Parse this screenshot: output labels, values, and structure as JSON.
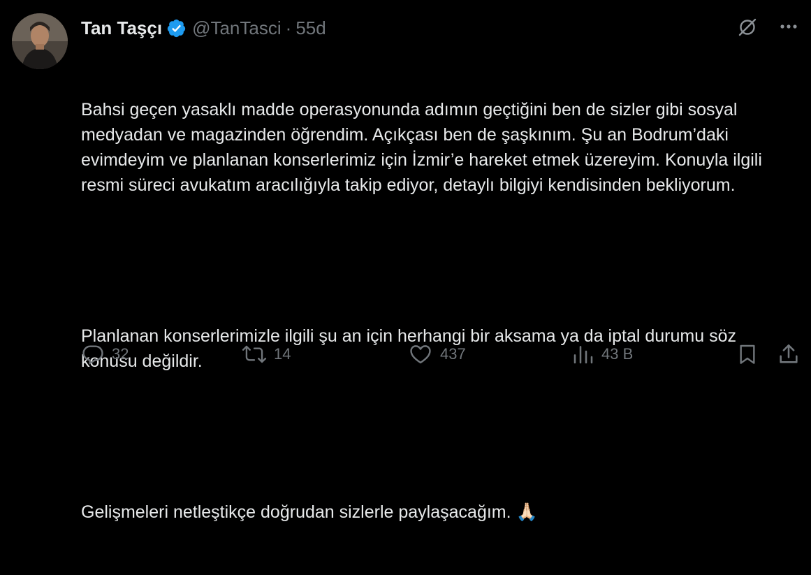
{
  "author": {
    "name": "Tan Taşçı",
    "handle": "@TanTasci",
    "separator": "·",
    "time": "55d",
    "verified_icon": "verified-badge-icon",
    "verified_color": "#1d9bf0"
  },
  "top_icons": [
    "grok-icon",
    "more-icon"
  ],
  "tweet": {
    "paragraphs": [
      "Bahsi geçen yasaklı madde operasyonunda adımın geçtiğini ben de sizler gibi sosyal medyadan ve magazinden öğrendim. Açıkçası ben de şaşkınım. Şu an Bodrum’daki evimdeyim ve planlanan konserlerimiz için İzmir’e hareket etmek üzereyim. Konuyla ilgili resmi süreci avukatım aracılığıyla takip ediyor, detaylı bilgiyi kendisinden bekliyorum.",
      "Planlanan konserlerimizle ilgili şu an için herhangi bir aksama ya da iptal durumu söz konusu değildir.",
      "Gelişmeleri netleştikçe doğrudan sizlerle paylaşacağım. 🙏🏻"
    ]
  },
  "actions": {
    "replies": "32",
    "reposts": "14",
    "likes": "437",
    "views": "43 B"
  },
  "colors": {
    "background": "#000000",
    "text": "#e7e9ea",
    "muted": "#71767b",
    "accent": "#1d9bf0"
  }
}
